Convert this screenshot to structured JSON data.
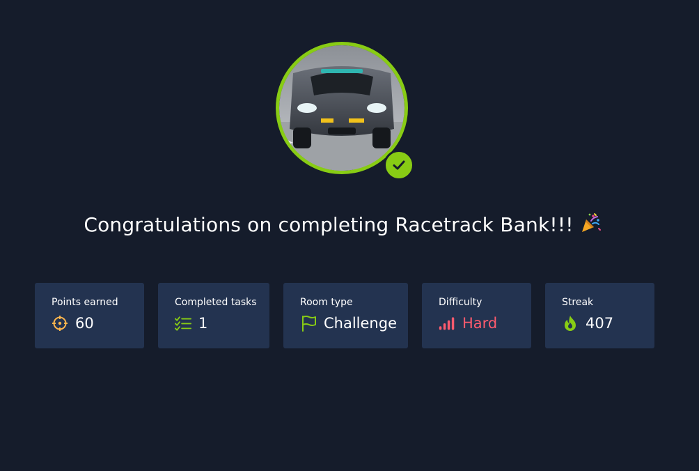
{
  "header": {
    "title": "Congratulations on completing Racetrack Bank!!!",
    "celebration_icon": "party-popper-icon"
  },
  "avatar": {
    "alt": "Racetrack Bank room image",
    "status_icon": "check-icon",
    "accent_color": "#88cc14"
  },
  "stats": [
    {
      "label": "Points earned",
      "value": "60",
      "icon": "crosshair-icon",
      "icon_color": "#ffb64d"
    },
    {
      "label": "Completed tasks",
      "value": "1",
      "icon": "task-list-icon",
      "icon_color": "#88cc14"
    },
    {
      "label": "Room type",
      "value": "Challenge",
      "icon": "flag-icon",
      "icon_color": "#88cc14"
    },
    {
      "label": "Difficulty",
      "value": "Hard",
      "icon": "signal-bars-icon",
      "icon_color": "#ff5b6e"
    },
    {
      "label": "Streak",
      "value": "407",
      "icon": "flame-icon",
      "icon_color": "#88cc14"
    }
  ],
  "colors": {
    "background": "#151c2b",
    "card": "#233350",
    "accent": "#88cc14",
    "danger": "#ff5b6e"
  }
}
